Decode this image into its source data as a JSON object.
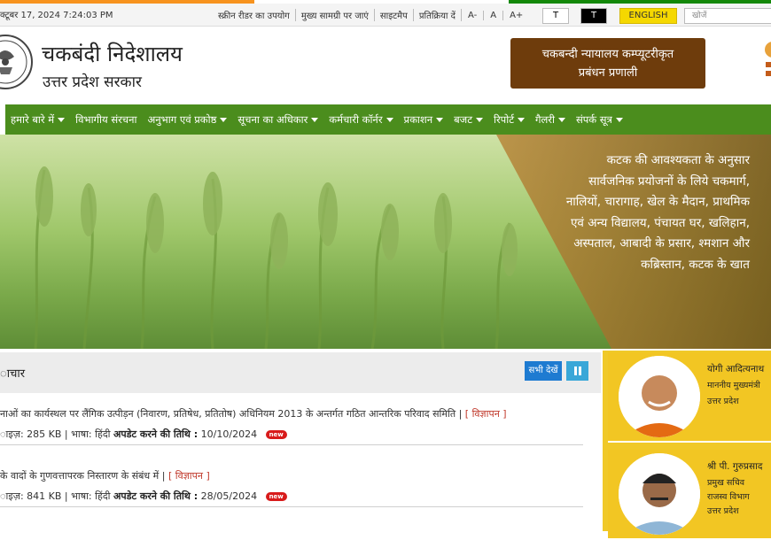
{
  "topbar": {
    "date": "क्टूबर 17, 2024 7:24:03 PM",
    "links": [
      "स्क्रीन रीडर का उपयोग",
      "मुख्य सामग्री पर जाएं",
      "साइटमैप",
      "प्रतिक्रिया दें"
    ],
    "font_decrease": "A-",
    "font_normal": "A",
    "font_increase": "A+",
    "theme_light": "T",
    "theme_dark": "T",
    "language_button": "ENGLISH",
    "search_placeholder": "खोजें"
  },
  "header": {
    "title": "चकबंदी निदेशालय",
    "subtitle": "उत्तर प्रदेश सरकार",
    "court_button_line1": "चकबन्दी न्यायालय कम्प्यूटरीकृत",
    "court_button_line2": "प्रबंधन प्रणाली"
  },
  "nav": {
    "items": [
      {
        "label": "हमारे बारे में",
        "dropdown": true
      },
      {
        "label": "विभागीय संरचना",
        "dropdown": false
      },
      {
        "label": "अनुभाग एवं प्रकोष्ठ",
        "dropdown": true
      },
      {
        "label": "सूचना का अधिकार",
        "dropdown": true
      },
      {
        "label": "कर्मचारी कॉर्नर",
        "dropdown": true
      },
      {
        "label": "प्रकाशन",
        "dropdown": true
      },
      {
        "label": "बजट",
        "dropdown": true
      },
      {
        "label": "रिपोर्ट",
        "dropdown": true
      },
      {
        "label": "गैलरी",
        "dropdown": true
      },
      {
        "label": "संपर्क सूत्र",
        "dropdown": true
      }
    ]
  },
  "banner": {
    "text": "कटक की आवश्यकता के अनुसार सार्वजनिक प्रयोजनों के लिये चकमार्ग, नालियों, चारागाह, खेल के मैदान, प्राथमिक एवं अन्य विद्यालय, पंचायत घर, खलिहान, अस्पताल, आबादी के प्रसार, श्मशान और कब्रिस्तान, कटक के खात"
  },
  "news": {
    "heading": "ाचार",
    "see_all": "सभी देखें",
    "items": [
      {
        "title": "नाओं का कार्यस्थल पर लैंगिक उत्पीड़न (निवारण, प्रतिषेध, प्रतितोष) अधिनियम 2013 के अन्तर्गत गठित आन्तरिक परिवाद समिति |",
        "tag": "[ विज्ञापन ]",
        "size_label": "ाइज़:",
        "size": "285 KB",
        "lang_label": "भाषा:",
        "lang": "हिंदी",
        "update_label": "अपडेट करने की तिथि :",
        "date": "10/10/2024",
        "badge": "new"
      },
      {
        "title": "के वादों के गुणवत्तापरक निस्तारण के संबंध में |",
        "tag": "[ विज्ञापन ]",
        "size_label": "ाइज़:",
        "size": "841 KB",
        "lang_label": "भाषा:",
        "lang": "हिंदी",
        "update_label": "अपडेट करने की तिथि :",
        "date": "28/05/2024",
        "badge": "new"
      }
    ]
  },
  "officials": [
    {
      "name": "योगी आदित्यनाथ",
      "designation1": "माननीय मुख्यमंत्री",
      "designation2": "उत्तर प्रदेश",
      "designation3": ""
    },
    {
      "name": "श्री पी. गुरुप्रसाद",
      "designation1": "प्रमुख सचिव",
      "designation2": "राजस्व विभाग",
      "designation3": "उत्तर प्रदेश"
    }
  ],
  "colors": {
    "nav_green": "#4b8d1d",
    "court_brown": "#6e3c0c",
    "lang_yellow": "#f5d800",
    "sidebar_yellow": "#f0c929",
    "see_all_blue": "#1e7bd1"
  }
}
